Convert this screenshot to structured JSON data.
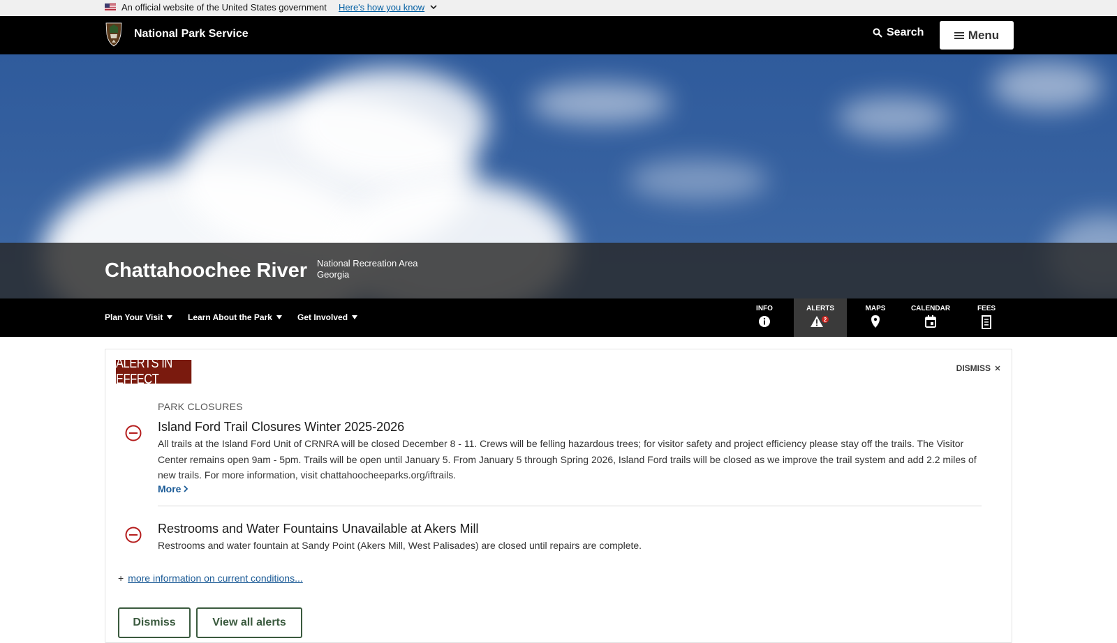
{
  "gov_banner": {
    "text": "An official website of the United States government",
    "link": "Here's how you know"
  },
  "header": {
    "brand": "National Park Service",
    "search_label": "Search",
    "menu_label": "Menu"
  },
  "park": {
    "name": "Chattahoochee River",
    "designation": "National Recreation Area",
    "state": "Georgia"
  },
  "park_nav": {
    "dropdowns": [
      "Plan Your Visit",
      "Learn About the Park",
      "Get Involved"
    ],
    "quick_links": [
      {
        "label": "INFO",
        "icon": "info-icon"
      },
      {
        "label": "ALERTS",
        "icon": "alert-warning-icon",
        "badge": "2"
      },
      {
        "label": "MAPS",
        "icon": "map-pin-icon"
      },
      {
        "label": "CALENDAR",
        "icon": "calendar-icon"
      },
      {
        "label": "FEES",
        "icon": "fees-receipt-icon"
      }
    ]
  },
  "alerts": {
    "heading": "ALERTS IN EFFECT",
    "dismiss_label": "DISMISS",
    "category": "PARK CLOSURES",
    "items": [
      {
        "title": "Island Ford Trail Closures Winter 2025-2026",
        "description": "All trails at the Island Ford Unit of CRNRA will be closed December 8 - 11. Crews will be felling hazardous trees; for visitor safety and project efficiency please stay off the trails. The Visitor Center remains open 9am - 5pm. Trails will be open until January 5. From January 5 through Spring 2026, Island Ford trails will be closed as we improve the trail system and add 2.2 miles of new trails. For more information, visit chattahoocheeparks.org/iftrails.",
        "more_label": "More"
      },
      {
        "title": "Restrooms and Water Fountains Unavailable at Akers Mill",
        "description": "Restrooms and water fountain at Sandy Point (Akers Mill, West Palisades) are closed until repairs are complete."
      }
    ],
    "more_info_link": "more information on current conditions...",
    "buttons": {
      "dismiss": "Dismiss",
      "view_all": "View all alerts"
    }
  },
  "colors": {
    "alert_tag_bg": "#7a1a0e",
    "link": "#1a5a96",
    "closure_icon": "#b51d1d",
    "button_border": "#3a5a3e"
  }
}
